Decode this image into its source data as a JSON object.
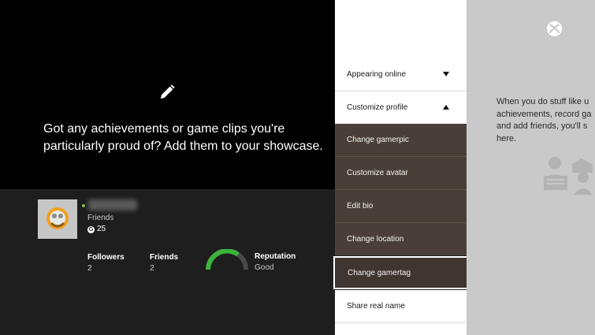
{
  "showcase": {
    "icon": "pencil-icon",
    "message": "Got any achievements or game clips you're particularly proud of? Add them to your showcase."
  },
  "profile": {
    "status": "Friends",
    "gamerscore": "25",
    "followers": {
      "label": "Followers",
      "value": "2"
    },
    "friends": {
      "label": "Friends",
      "value": "2"
    },
    "reputation": {
      "label": "Reputation",
      "value": "Good"
    }
  },
  "menu": {
    "items": [
      {
        "label": "Appearing online"
      },
      {
        "label": "Customize profile"
      },
      {
        "label": "Change gamerpic"
      },
      {
        "label": "Customize avatar"
      },
      {
        "label": "Edit bio"
      },
      {
        "label": "Change location"
      },
      {
        "label": "Change gamertag"
      },
      {
        "label": "Share real name"
      }
    ]
  },
  "right_panel": {
    "text": "When you do stuff like u\nachievements, record ga\nand add friends, you'll s\nhere."
  },
  "colors": {
    "online": "#7cc242",
    "reputation_good": "#3bb53b",
    "submenu_bg": "#4a3f38"
  }
}
